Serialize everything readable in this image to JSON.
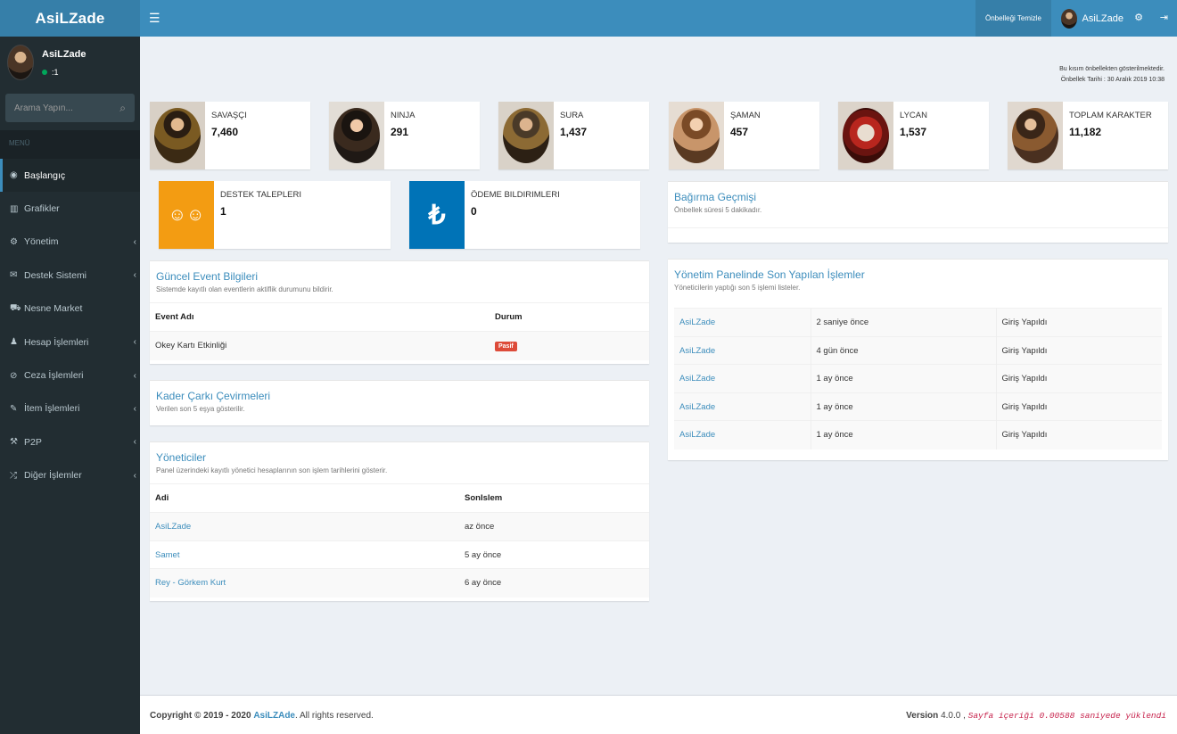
{
  "app": {
    "logo": "AsiLZade"
  },
  "header": {
    "clear_cache_label": "Önbelleği Temizle",
    "user_name": "AsiLZade"
  },
  "sidebar": {
    "user_name": "AsiLZade",
    "user_status": ":1",
    "search_placeholder": "Arama Yapın...",
    "menu_header": "MENÜ",
    "items": [
      {
        "label": "Başlangıç",
        "icon": "dashboard-icon",
        "glyph": "◉",
        "chev": false,
        "active": true
      },
      {
        "label": "Grafikler",
        "icon": "bar-chart-icon",
        "glyph": "▥",
        "chev": false,
        "active": false
      },
      {
        "label": "Yönetim",
        "icon": "cogs-icon",
        "glyph": "⚙",
        "chev": true,
        "active": false
      },
      {
        "label": "Destek Sistemi",
        "icon": "comments-icon",
        "glyph": "✉",
        "chev": true,
        "active": false
      },
      {
        "label": "Nesne Market",
        "icon": "cart-icon",
        "glyph": "⛟",
        "chev": false,
        "active": false
      },
      {
        "label": "Hesap İşlemleri",
        "icon": "user-icon",
        "glyph": "♟",
        "chev": true,
        "active": false
      },
      {
        "label": "Ceza İşlemleri",
        "icon": "ban-icon",
        "glyph": "⊘",
        "chev": true,
        "active": false
      },
      {
        "label": "İtem İşlemleri",
        "icon": "edit-icon",
        "glyph": "✎",
        "chev": true,
        "active": false
      },
      {
        "label": "P2P",
        "icon": "gavel-icon",
        "glyph": "⚒",
        "chev": true,
        "active": false
      },
      {
        "label": "Diğer İşlemler",
        "icon": "random-icon",
        "glyph": "⤮",
        "chev": true,
        "active": false
      }
    ]
  },
  "cache_note": {
    "line1": "Bu kısım önbellekten gösterilmektedir.",
    "line2": "Önbellek Tarihi : 30 Aralık 2019 10:38"
  },
  "stats": [
    {
      "label": "SAVAŞÇI",
      "value": "7,460"
    },
    {
      "label": "NINJA",
      "value": "291"
    },
    {
      "label": "SURA",
      "value": "1,437"
    },
    {
      "label": "ŞAMAN",
      "value": "457"
    },
    {
      "label": "LYCAN",
      "value": "1,537"
    },
    {
      "label": "TOPLAM KARAKTER",
      "value": "11,182"
    }
  ],
  "support": {
    "label": "DESTEK TALEPLERI",
    "value": "1",
    "color": "#f39c12"
  },
  "payment": {
    "label": "ÖDEME BILDIRIMLERI",
    "value": "0",
    "color": "#0073b7",
    "glyph": "₺"
  },
  "events": {
    "title": "Güncel Event Bilgileri",
    "subtitle": "Sistemde kayıtlı olan eventlerin aktiflik durumunu bildirir.",
    "col_name": "Event Adı",
    "col_status": "Durum",
    "rows": [
      {
        "name": "Okey Kartı Etkinliği",
        "status": "Pasif"
      }
    ]
  },
  "wheel": {
    "title": "Kader Çarkı Çevirmeleri",
    "subtitle": "Verilen son 5 eşya gösterilir."
  },
  "admins": {
    "title": "Yöneticiler",
    "subtitle": "Panel üzerindeki kayıtlı yönetici hesaplarının son işlem tarihlerini gösterir.",
    "col_name": "Adi",
    "col_last": "SonIslem",
    "rows": [
      {
        "name": "AsiLZade",
        "last": "az önce"
      },
      {
        "name": "Samet",
        "last": "5 ay önce"
      },
      {
        "name": "Rey - Görkem Kurt",
        "last": "6 ay önce"
      }
    ]
  },
  "shout": {
    "title": "Bağırma Geçmişi",
    "subtitle": "Önbellek süresi 5 dakikadır."
  },
  "actions": {
    "title": "Yönetim Panelinde Son Yapılan İşlemler",
    "subtitle": "Yöneticilerin yaptığı son 5 işlemi listeler.",
    "rows": [
      {
        "user": "AsiLZade",
        "time": "2 saniye önce",
        "action": "Giriş Yapıldı"
      },
      {
        "user": "AsiLZade",
        "time": "4 gün önce",
        "action": "Giriş Yapıldı"
      },
      {
        "user": "AsiLZade",
        "time": "1 ay önce",
        "action": "Giriş Yapıldı"
      },
      {
        "user": "AsiLZade",
        "time": "1 ay önce",
        "action": "Giriş Yapıldı"
      },
      {
        "user": "AsiLZade",
        "time": "1 ay önce",
        "action": "Giriş Yapıldı"
      }
    ]
  },
  "footer": {
    "copyright": "Copyright © 2019 - 2020",
    "brand": "AsiLZAde",
    "rights": ". All rights reserved.",
    "version_label": "Version",
    "version": "4.0.0 ,",
    "load_time": "Sayfa içeriği 0.00588 saniyede yüklendi"
  }
}
